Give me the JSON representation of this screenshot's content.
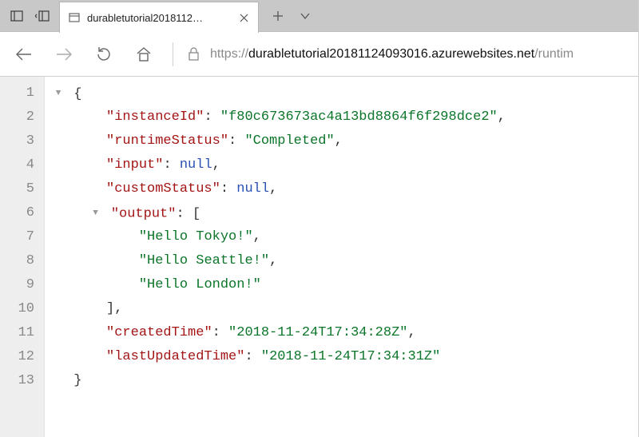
{
  "titlebar": {
    "tab_title": "durabletutorial2018112…"
  },
  "toolbar": {
    "url_scheme": "https://",
    "url_host": "durabletutorial20181124093016.azurewebsites.net",
    "url_path_trunc": "/runtim"
  },
  "json_body": {
    "instanceId": "f80c673673ac4a13bd8864f6f298dce2",
    "runtimeStatus": "Completed",
    "input": "null",
    "customStatus": "null",
    "output": [
      "Hello Tokyo!",
      "Hello Seattle!",
      "Hello London!"
    ],
    "createdTime": "2018-11-24T17:34:28Z",
    "lastUpdatedTime": "2018-11-24T17:34:31Z"
  },
  "line_numbers": [
    "1",
    "2",
    "3",
    "4",
    "5",
    "6",
    "7",
    "8",
    "9",
    "10",
    "11",
    "12",
    "13"
  ],
  "keys": {
    "instanceId": "instanceId",
    "runtimeStatus": "runtimeStatus",
    "input": "input",
    "customStatus": "customStatus",
    "output": "output",
    "createdTime": "createdTime",
    "lastUpdatedTime": "lastUpdatedTime"
  }
}
